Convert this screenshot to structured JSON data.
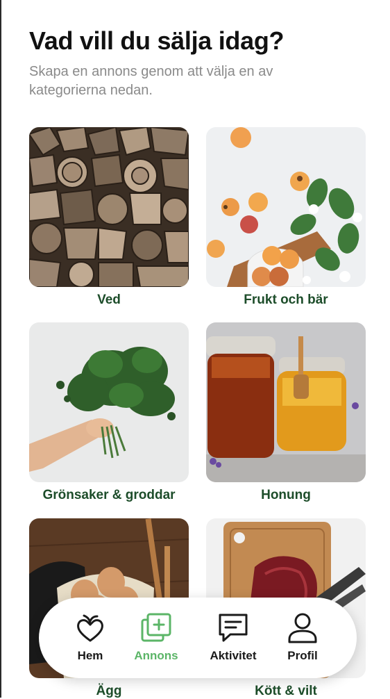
{
  "header": {
    "title": "Vad vill du sälja idag?",
    "subtitle": "Skapa en annons genom att välja en av kategorierna nedan."
  },
  "categories": [
    {
      "label": "Ved",
      "image": "firewood-photo"
    },
    {
      "label": "Frukt och bär",
      "image": "apricots-photo"
    },
    {
      "label": "Grönsaker & groddar",
      "image": "kale-photo"
    },
    {
      "label": "Honung",
      "image": "honey-jars-photo"
    },
    {
      "label": "Ägg",
      "image": "eggs-basket-photo"
    },
    {
      "label": "Kött & vilt",
      "image": "meat-on-board-photo"
    }
  ],
  "nav": {
    "items": [
      {
        "label": "Hem",
        "icon": "heart-sprout-icon"
      },
      {
        "label": "Annons",
        "icon": "add-listing-icon",
        "active": true
      },
      {
        "label": "Aktivitet",
        "icon": "message-icon"
      },
      {
        "label": "Profil",
        "icon": "user-icon"
      }
    ],
    "active_color": "#5bb567"
  },
  "colors": {
    "label": "#1d4d2a",
    "subtitle": "#8a8a8a",
    "title": "#111111"
  }
}
